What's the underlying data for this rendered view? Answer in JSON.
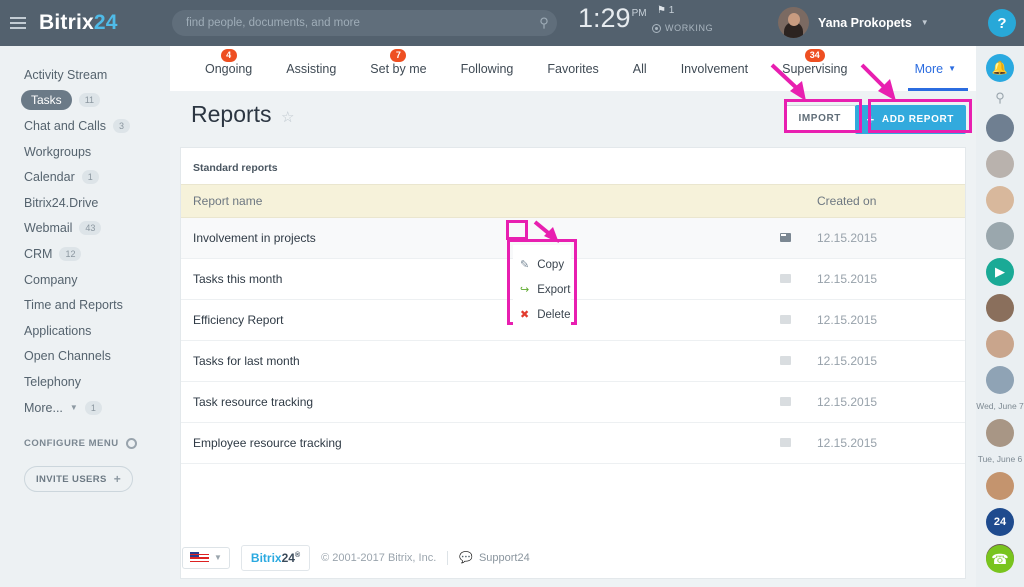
{
  "topbar": {
    "logo_text": "Bitrix",
    "logo_num": "24",
    "menu_icon": "hamburger-icon",
    "search": {
      "placeholder": "find people, documents, and more",
      "value": "",
      "icon": "search-icon"
    },
    "clock": {
      "time": "1:29",
      "ampm": "PM"
    },
    "flag_count": "1",
    "status_label": "WORKING",
    "user_name": "Yana Prokopets",
    "help_label": "?"
  },
  "sidebar": {
    "items": [
      {
        "label": "Activity Stream",
        "count": "",
        "active": false
      },
      {
        "label": "Tasks",
        "count": "11",
        "active": true
      },
      {
        "label": "Chat and Calls",
        "count": "3",
        "active": false
      },
      {
        "label": "Workgroups",
        "count": "",
        "active": false
      },
      {
        "label": "Calendar",
        "count": "1",
        "active": false
      },
      {
        "label": "Bitrix24.Drive",
        "count": "",
        "active": false
      },
      {
        "label": "Webmail",
        "count": "43",
        "active": false
      },
      {
        "label": "CRM",
        "count": "12",
        "active": false
      },
      {
        "label": "Company",
        "count": "",
        "active": false
      },
      {
        "label": "Time and Reports",
        "count": "",
        "active": false
      },
      {
        "label": "Applications",
        "count": "",
        "active": false
      },
      {
        "label": "Open Channels",
        "count": "",
        "active": false
      },
      {
        "label": "Telephony",
        "count": "",
        "active": false
      },
      {
        "label": "More... ",
        "count": "1",
        "active": false
      }
    ],
    "configure_menu": "CONFIGURE MENU",
    "invite_users": "INVITE USERS"
  },
  "tabs": [
    {
      "label": "Ongoing",
      "badge": "4"
    },
    {
      "label": "Assisting",
      "badge": ""
    },
    {
      "label": "Set by me",
      "badge": "7"
    },
    {
      "label": "Following",
      "badge": ""
    },
    {
      "label": "Favorites",
      "badge": ""
    },
    {
      "label": "All",
      "badge": ""
    },
    {
      "label": "Involvement",
      "badge": ""
    },
    {
      "label": "Supervising",
      "badge": "34"
    }
  ],
  "more_tab": {
    "label": "More",
    "badge": ""
  },
  "page": {
    "title": "Reports",
    "star_icon": "star-outline-icon",
    "import_button": "IMPORT",
    "add_report_button": "ADD REPORT",
    "section_title": "Standard reports"
  },
  "table": {
    "columns": {
      "name": "Report name",
      "created": "Created on"
    },
    "rows": [
      {
        "name": "Involvement in projects",
        "created": "12.15.2015",
        "active": true
      },
      {
        "name": "Tasks this month",
        "created": "12.15.2015",
        "active": false
      },
      {
        "name": "Efficiency Report",
        "created": "12.15.2015",
        "active": false
      },
      {
        "name": "Tasks for last month",
        "created": "12.15.2015",
        "active": false
      },
      {
        "name": "Task resource tracking",
        "created": "12.15.2015",
        "active": false
      },
      {
        "name": "Employee resource tracking",
        "created": "12.15.2015",
        "active": false
      }
    ]
  },
  "context_menu": {
    "items": [
      {
        "label": "Copy",
        "icon": "copy-icon"
      },
      {
        "label": "Export",
        "icon": "export-icon"
      },
      {
        "label": "Delete",
        "icon": "delete-icon"
      }
    ]
  },
  "footer": {
    "language": "US",
    "logo_text": "Bitrix",
    "logo_num": "24",
    "copyright": "© 2001-2017 Bitrix, Inc.",
    "support": "Support24"
  },
  "rail": {
    "date_labels": [
      "Wed, June 7",
      "Tue, June 6"
    ],
    "badge_24": "24"
  },
  "colors": {
    "accent_blue": "#2aa9e0",
    "highlight_pink": "#e81fb0",
    "badge_orange": "#ee4f22",
    "topbar": "#53616e",
    "link_blue": "#2b6ce0",
    "green": "#79c41e"
  }
}
